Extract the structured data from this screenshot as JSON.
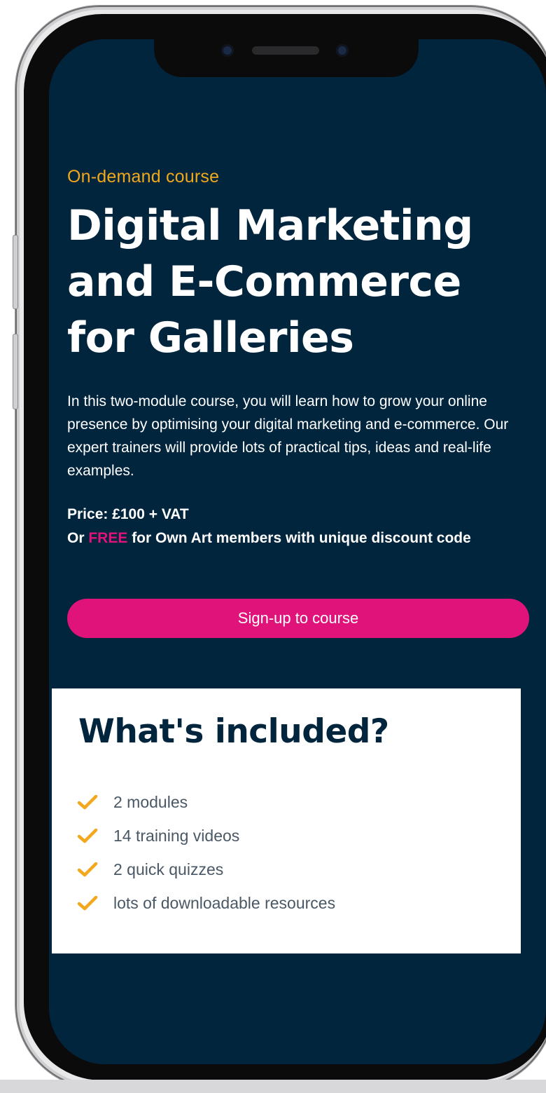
{
  "course": {
    "kicker": "On-demand course",
    "title": "Digital Marketing and E-Commerce for Galleries",
    "description": "In this two-module course, you will learn how to grow your online presence by optimising your digital marketing and e-commerce. Our expert trainers will provide lots of practical tips, ideas and real-life examples.",
    "price": "Price: £100 + VAT",
    "offer_prefix": "Or ",
    "offer_highlight": "FREE",
    "offer_suffix": " for Own Art members with unique discount code",
    "signup_label": "Sign-up to course"
  },
  "included": {
    "heading": "What's included?",
    "items": [
      {
        "label": "2 modules"
      },
      {
        "label": "14 training videos"
      },
      {
        "label": "2 quick quizzes"
      },
      {
        "label": "lots of downloadable resources"
      }
    ],
    "check_icon": "checkmark-icon"
  },
  "colors": {
    "background": "#02253e",
    "accent_orange": "#f2a81c",
    "accent_pink": "#e0137a",
    "text_white": "#ffffff",
    "heading_navy": "#02253e"
  }
}
